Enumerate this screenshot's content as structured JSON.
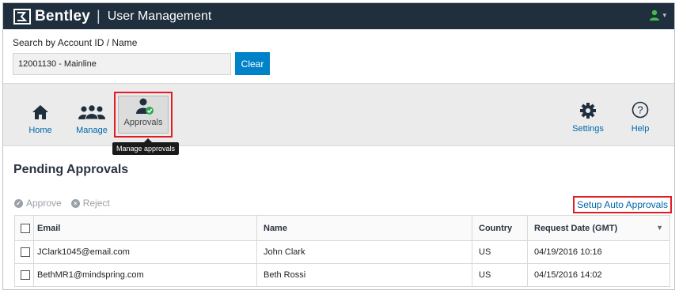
{
  "header": {
    "brand": "Bentley",
    "separator": "|",
    "app_title": "User Management",
    "colors": {
      "bar": "#1f2f3d",
      "user_icon": "#3fbf4a"
    }
  },
  "search": {
    "label": "Search by Account ID / Name",
    "value": "12001130 - Mainline",
    "clear_label": "Clear"
  },
  "nav": {
    "items": [
      {
        "label": "Home",
        "icon": "home-icon"
      },
      {
        "label": "Manage",
        "icon": "users-icon"
      },
      {
        "label": "Approvals",
        "icon": "user-check-icon",
        "selected": true
      },
      {
        "label": "Settings",
        "icon": "gear-icon"
      },
      {
        "label": "Help",
        "icon": "help-icon"
      }
    ],
    "tooltip": "Manage approvals"
  },
  "page": {
    "title": "Pending Approvals",
    "approve_label": "Approve",
    "reject_label": "Reject",
    "setup_link": "Setup Auto Approvals"
  },
  "table": {
    "headers": [
      "Email",
      "Name",
      "Country",
      "Request Date (GMT)"
    ],
    "rows": [
      [
        "JClark1045@email.com",
        "John Clark",
        "US",
        "04/19/2016 10:16"
      ],
      [
        "BethMR1@mindspring.com",
        "Beth Rossi",
        "US",
        "04/15/2016 14:02"
      ]
    ]
  }
}
